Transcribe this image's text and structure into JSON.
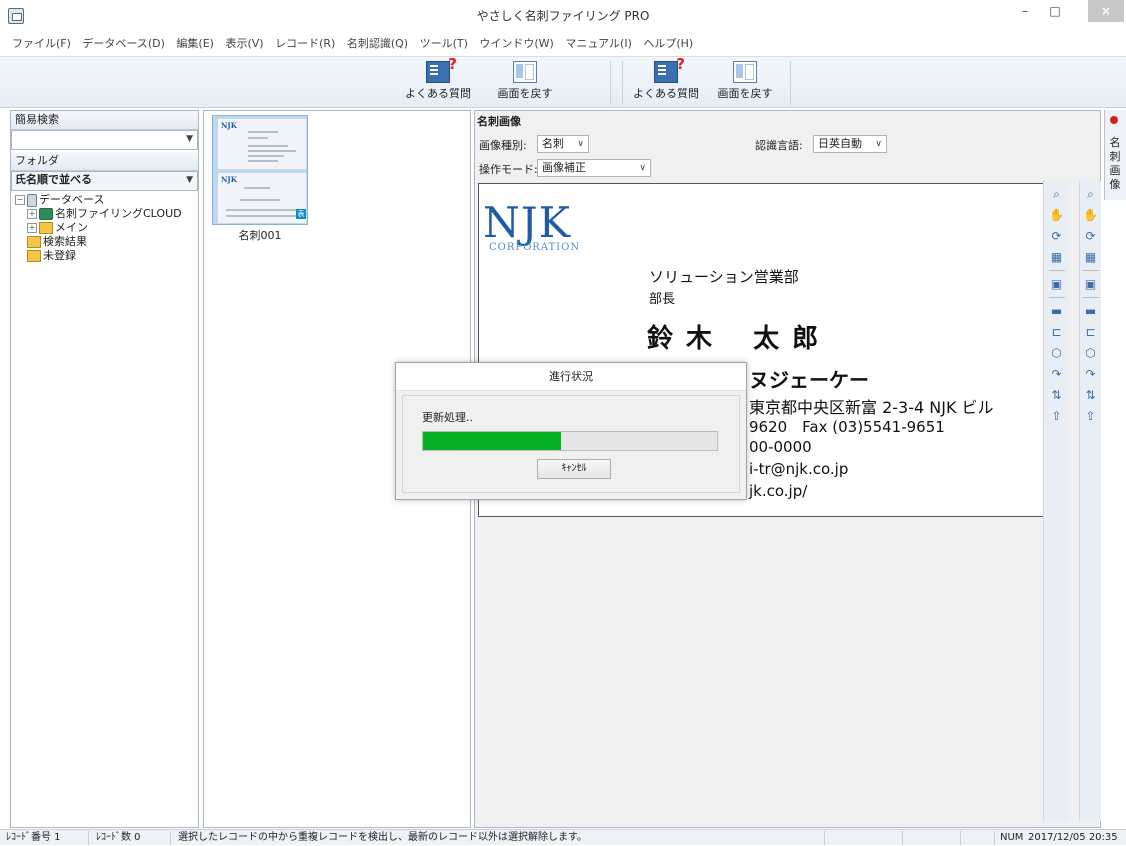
{
  "window": {
    "title": "やさしく名刺ファイリング PRO",
    "min_glyph": "–",
    "max_glyph": "□",
    "close_glyph": "×"
  },
  "menu": [
    "ファイル(F)",
    "データベース(D)",
    "編集(E)",
    "表示(V)",
    "レコード(R)",
    "名刺認識(Q)",
    "ツール(T)",
    "ウインドウ(W)",
    "マニュアル(I)",
    "ヘルプ(H)"
  ],
  "toolbar": {
    "faq_label": "よくある質問",
    "back_label": "画面を戻す",
    "faq_label_2": "よくある質問",
    "back_label_2": "画面を戻す"
  },
  "left": {
    "quick_search_label": "簡易検索",
    "quick_search_value": "",
    "folder_label": "フォルダ",
    "sort_value": "氏名順で並べる",
    "tree": {
      "database": "データベース",
      "cloud": "名刺ファイリングCLOUD",
      "main": "メイン",
      "search_results": "検索結果",
      "unregistered": "未登録"
    }
  },
  "thumbnail": {
    "label": "名刺001",
    "logo": "NJK",
    "badge": "表"
  },
  "right": {
    "title": "名刺画像",
    "image_type_label": "画像種別:",
    "image_type_value": "名刺",
    "language_label": "認識言語:",
    "language_value": "日英自動",
    "mode_label": "操作モード:",
    "mode_value": "画像補正"
  },
  "card": {
    "logo": "NJK",
    "logo_sub": "CORPORATION",
    "department": "ソリューション営業部",
    "title": "部長",
    "name": "鈴 木　 太 郎",
    "company": "ヌジェーケー",
    "address": "東京都中央区新富 2-3-4 NJK ビル",
    "phone": "9620　Fax (03)5541-9651",
    "mobile": "00-0000",
    "email": "i-tr@njk.co.jp",
    "web": "jk.co.jp/"
  },
  "side_tab": {
    "label": "名刺画像"
  },
  "dialog": {
    "title": "進行状況",
    "status": "更新処理..",
    "progress": 0.47,
    "cancel_label": "ｷｬﾝｾﾙ"
  },
  "statusbar": {
    "record_no": "ﾚｺｰﾄﾞ番号 1",
    "record_count": "ﾚｺｰﾄﾞ数 0",
    "message": "選択したレコードの中から重複レコードを検出し、最新のレコード以外は選択解除します。",
    "num": "NUM",
    "datetime": "2017/12/05 20:35"
  },
  "colors": {
    "progress_fill": "#06b025",
    "brand_blue": "#1f5ca8"
  }
}
